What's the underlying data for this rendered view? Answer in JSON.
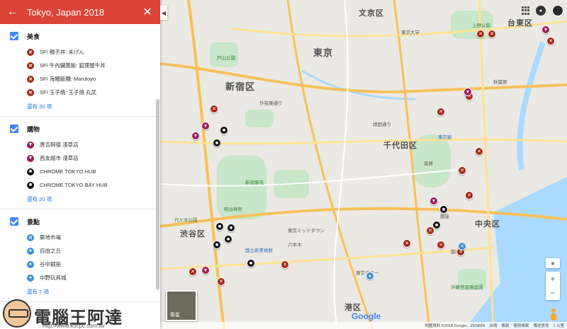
{
  "panel": {
    "back_icon": "arrow-left-icon",
    "title": "Tokyo, Japan 2018",
    "close_icon": "close-icon",
    "layers": [
      {
        "name": "美食",
        "items": [
          {
            "label": "SF/ 親子丼: 末げん",
            "type": "food"
          },
          {
            "label": "SF/ 牛內臟蓋飯: 狐狸屋牛丼",
            "type": "food"
          },
          {
            "label": "SF/ 海鰻飯糰: Marutoyo",
            "type": "food"
          },
          {
            "label": "SF/ 玉子燒: 玉子燒 丸武",
            "type": "food"
          }
        ],
        "more": "還有 30 項"
      },
      {
        "name": "購物",
        "items": [
          {
            "label": "唐吉軻德 淺草店",
            "type": "shop"
          },
          {
            "label": "西友超市 淺草店",
            "type": "shop"
          },
          {
            "label": "CHROME TOKYO HUB",
            "type": "hub"
          },
          {
            "label": "CHROME TOKYO BAY HUB",
            "type": "hub"
          }
        ],
        "more": "還有 20 項"
      },
      {
        "name": "景點",
        "items": [
          {
            "label": "築地市場",
            "type": "sight"
          },
          {
            "label": "自由之丘",
            "type": "sight"
          },
          {
            "label": "谷中銀座",
            "type": "sight"
          },
          {
            "label": "中野玩具城",
            "type": "sight"
          }
        ],
        "more": "還有 7 項"
      }
    ]
  },
  "logo": {
    "main": "電腦王阿達",
    "url": "http://www.kocpc.com.tw"
  },
  "map": {
    "wards": [
      {
        "label": "文京区",
        "cls": "ward"
      },
      {
        "label": "台東区",
        "cls": "ward"
      },
      {
        "label": "新宿区",
        "cls": "ward big"
      },
      {
        "label": "東京",
        "cls": "ward big"
      },
      {
        "label": "千代田区",
        "cls": "ward"
      },
      {
        "label": "中央区",
        "cls": "ward"
      },
      {
        "label": "渋谷区",
        "cls": "ward"
      },
      {
        "label": "港区",
        "cls": "ward"
      }
    ],
    "pois": [
      {
        "label": "東京大学",
        "cls": "poi"
      },
      {
        "label": "上野公園",
        "cls": "poi green"
      },
      {
        "label": "戸山公園",
        "cls": "poi green"
      },
      {
        "label": "新宿御苑",
        "cls": "poi green"
      },
      {
        "label": "明治神宮",
        "cls": "poi green"
      },
      {
        "label": "代々木公園",
        "cls": "poi green"
      },
      {
        "label": "皇居",
        "cls": "poi"
      },
      {
        "label": "東京駅",
        "cls": "poi blue"
      },
      {
        "label": "六本木",
        "cls": "poi"
      },
      {
        "label": "東京タワー",
        "cls": "poi"
      },
      {
        "label": "銀座",
        "cls": "poi"
      },
      {
        "label": "築地",
        "cls": "poi"
      },
      {
        "label": "外苑東通り",
        "cls": "poi"
      },
      {
        "label": "靖国通り",
        "cls": "poi"
      },
      {
        "label": "秋葉原",
        "cls": "poi"
      },
      {
        "label": "浜離宮恩賜庭園",
        "cls": "poi green"
      },
      {
        "label": "国立新美術館",
        "cls": "poi blue"
      },
      {
        "label": "東京ミッドタウン",
        "cls": "poi"
      }
    ],
    "markers_food": 18,
    "satellite_label": "衛星",
    "google": "Google",
    "attribution": [
      "地圖資料 ©2018 Google、ZENRIN",
      "台灣",
      "條款",
      "使用條款",
      "傳送意見",
      "1 公里"
    ],
    "zoom_in": "+",
    "zoom_out": "−"
  },
  "colors": {
    "header": "#db4437",
    "food": "#a52714",
    "shop": "#9c1c5b",
    "hub": "#111111",
    "sight": "#3f8fdb",
    "accent": "#4285f4"
  }
}
